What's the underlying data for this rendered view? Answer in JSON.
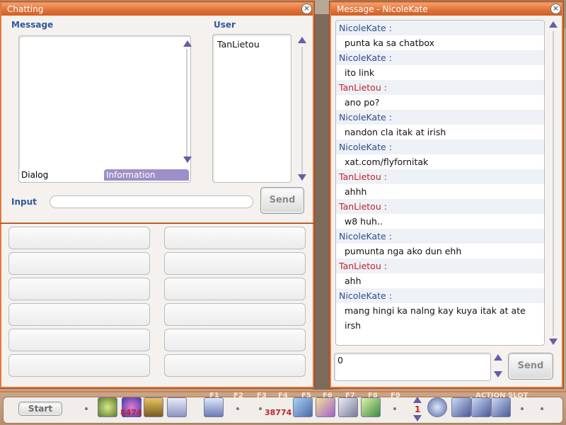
{
  "chat_window": {
    "title": "Chatting",
    "message_label": "Message",
    "user_label": "User",
    "users": [
      "TanLietou"
    ],
    "tabs": {
      "dialog": "Dialog",
      "information": "Information"
    },
    "input_label": "Input",
    "input_value": "",
    "send_label": "Send"
  },
  "pm_window": {
    "title": "Message - NicoleKate",
    "messages": [
      {
        "sender": "NicoleKate :",
        "text": "punta ka sa chatbox",
        "who": "nicole"
      },
      {
        "sender": "NicoleKate :",
        "text": "ito link",
        "who": "nicole"
      },
      {
        "sender": "TanLietou :",
        "text": "ano po?",
        "who": "tan"
      },
      {
        "sender": "NicoleKate :",
        "text": "nandon cla itak at irish",
        "who": "nicole"
      },
      {
        "sender": "NicoleKate :",
        "text": "xat.com/flyfornitak",
        "who": "nicole"
      },
      {
        "sender": "TanLietou :",
        "text": "ahhh",
        "who": "tan"
      },
      {
        "sender": "TanLietou :",
        "text": "w8 huh..",
        "who": "tan"
      },
      {
        "sender": "NicoleKate :",
        "text": "pumunta nga ako dun ehh",
        "who": "nicole"
      },
      {
        "sender": "TanLietou :",
        "text": "ahh",
        "who": "tan"
      },
      {
        "sender": "NicoleKate :",
        "text": "mang hingi ka nalng kay kuya itak at ate irsh",
        "who": "nicole"
      }
    ],
    "input_value": "0",
    "send_label": "Send"
  },
  "taskbar": {
    "start_label": "Start",
    "fkeys": [
      "F1",
      "F2",
      "F3",
      "F4",
      "F5",
      "F6",
      "F7",
      "F8",
      "F9"
    ],
    "count_a": "8474",
    "count_b": "38774",
    "page_number": "1",
    "action_slot_label": "ACTION SLOT",
    "colors": {
      "window_border": "#e07a3c",
      "name_blue": "#2d4f8e",
      "name_red": "#c0232a"
    },
    "icons": [
      "helmet-icon",
      "potion-icon",
      "scroll-icon",
      "wing-icon",
      "sword-icon",
      "skill-icon",
      "staff-icon",
      "hammer-icon",
      "wand-icon",
      "slot-icon"
    ]
  }
}
